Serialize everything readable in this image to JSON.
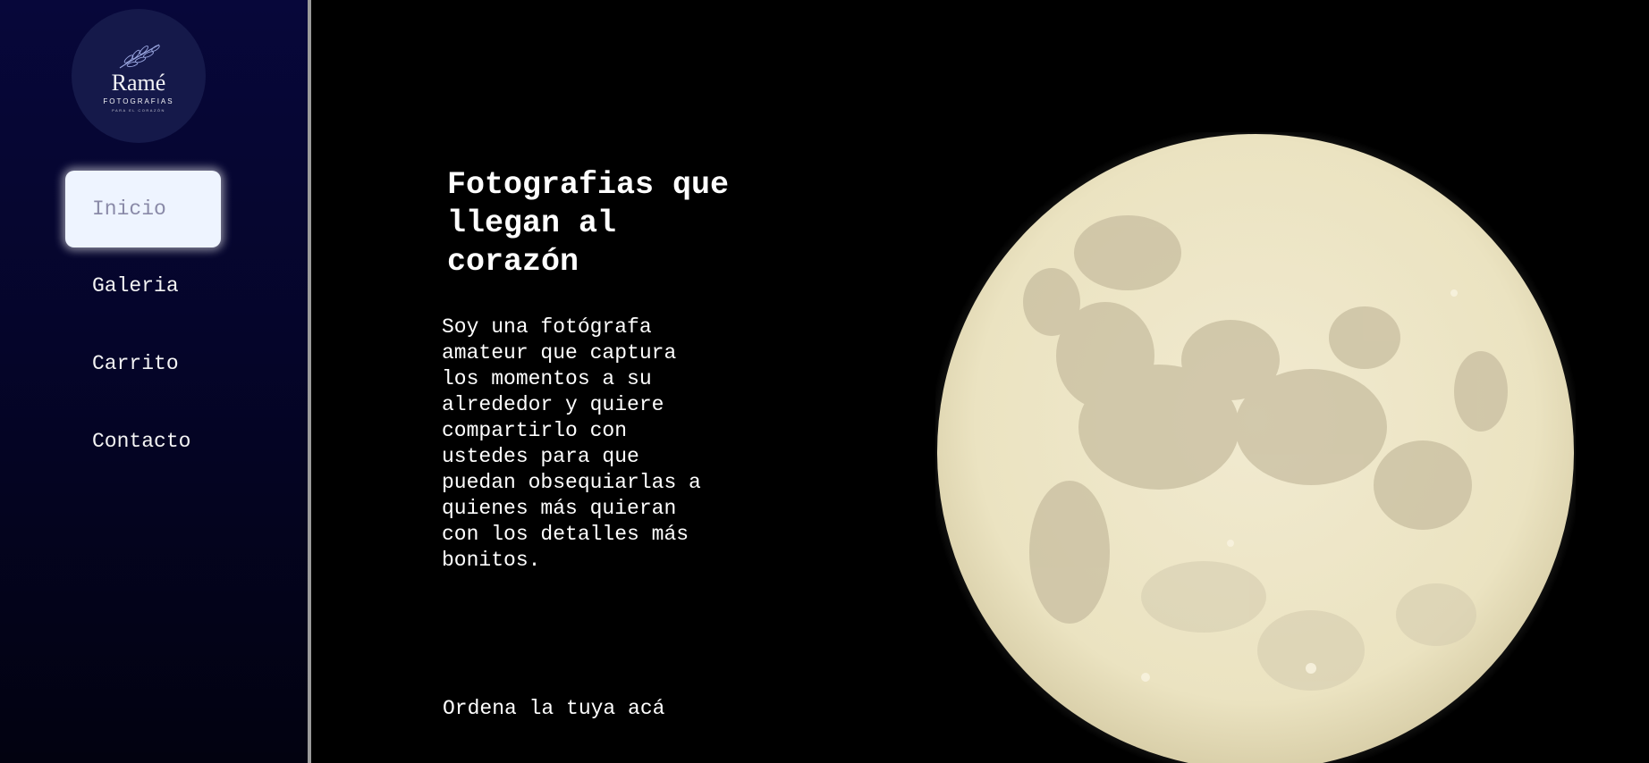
{
  "logo": {
    "name": "Ramé",
    "subtitle": "FOTOGRAFIAS",
    "tagline": "PARA EL CORAZÓN",
    "icon": "leaf-branch-icon"
  },
  "nav": {
    "items": [
      {
        "label": "Inicio",
        "active": true
      },
      {
        "label": "Galeria",
        "active": false
      },
      {
        "label": "Carrito",
        "active": false
      },
      {
        "label": "Contacto",
        "active": false
      }
    ]
  },
  "hero": {
    "title": "Fotografias que llegan al corazón",
    "description": "Soy una fotógrafa amateur que captura los momentos a su alrededor y quiere compartirlo con ustedes para que puedan obsequiarlas a quienes más quieran con los detalles más bonitos.",
    "cta": "Ordena la tuya acá"
  },
  "colors": {
    "sidebar": "#07073a",
    "main_background": "#000000",
    "active_nav": "#eef4ff",
    "moon": "#efe8c8"
  }
}
